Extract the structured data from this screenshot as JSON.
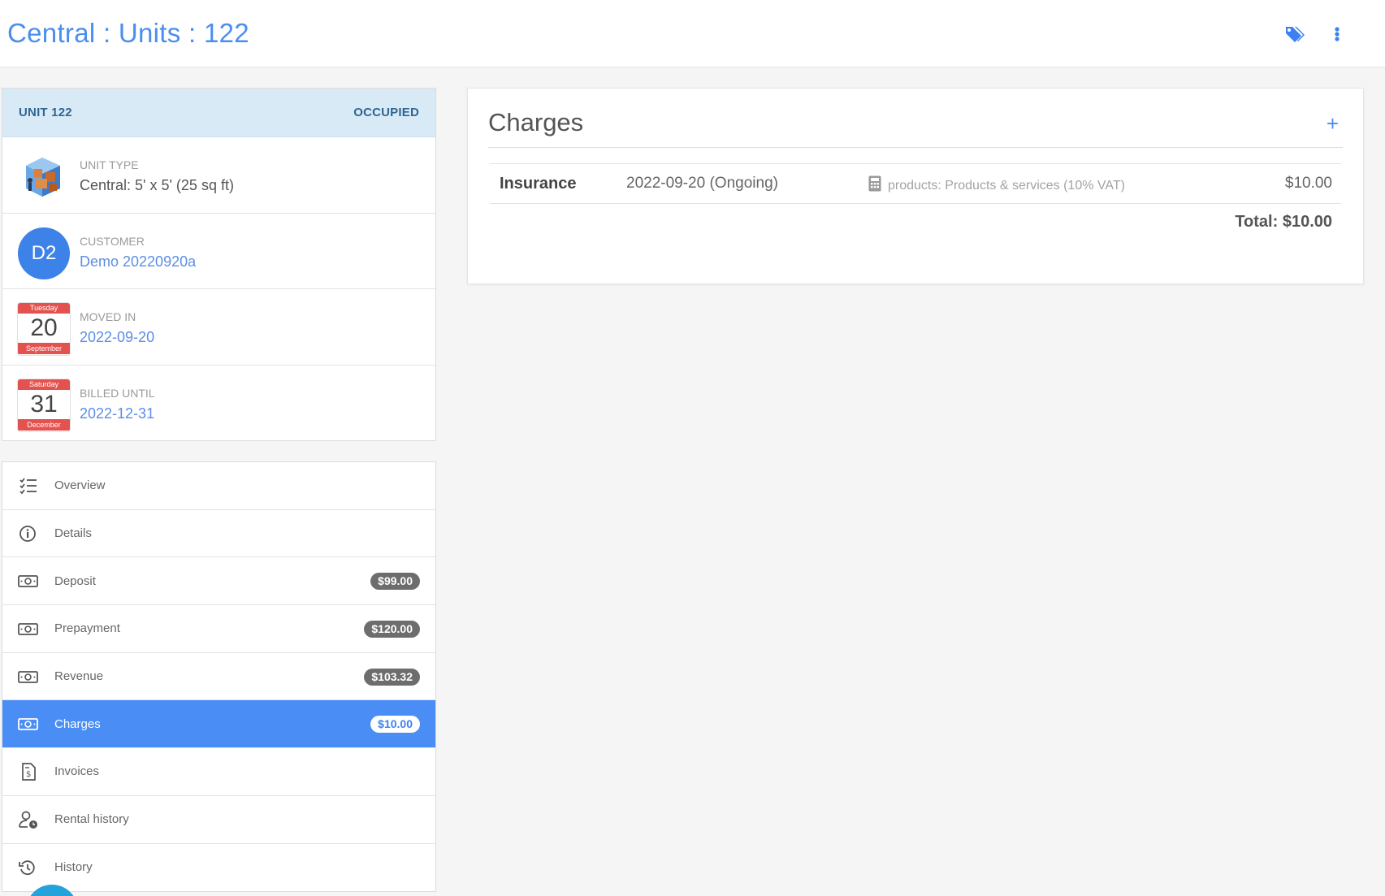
{
  "header": {
    "title": "Central : Units : 122",
    "tag_icon": "tags-icon",
    "more_icon": "more-vertical-icon"
  },
  "unit": {
    "name": "UNIT 122",
    "status": "OCCUPIED",
    "unit_type_label": "UNIT TYPE",
    "unit_type_value": "Central: 5' x 5' (25 sq ft)",
    "customer_label": "CUSTOMER",
    "customer_initials": "D2",
    "customer_value": "Demo 20220920a",
    "moved_in_label": "MOVED IN",
    "moved_in_value": "2022-09-20",
    "moved_in_cal": {
      "weekday": "Tuesday",
      "day": "20",
      "month": "September"
    },
    "billed_until_label": "BILLED UNTIL",
    "billed_until_value": "2022-12-31",
    "billed_until_cal": {
      "weekday": "Saturday",
      "day": "31",
      "month": "December"
    }
  },
  "nav": {
    "items": [
      {
        "label": "Overview",
        "icon": "checklist-icon"
      },
      {
        "label": "Details",
        "icon": "info-icon"
      },
      {
        "label": "Deposit",
        "icon": "money-icon",
        "badge": "$99.00"
      },
      {
        "label": "Prepayment",
        "icon": "money-icon",
        "badge": "$120.00"
      },
      {
        "label": "Revenue",
        "icon": "money-icon",
        "badge": "$103.32"
      },
      {
        "label": "Charges",
        "icon": "money-icon",
        "badge": "$10.00",
        "active": true
      },
      {
        "label": "Invoices",
        "icon": "invoice-icon"
      },
      {
        "label": "Rental history",
        "icon": "user-clock-icon"
      },
      {
        "label": "History",
        "icon": "history-icon"
      }
    ]
  },
  "charges": {
    "title": "Charges",
    "add_label": "+",
    "rows": [
      {
        "name": "Insurance",
        "date": "2022-09-20 (Ongoing)",
        "product": "products: Products & services (10% VAT)",
        "product_icon": "calculator-icon",
        "amount": "$10.00"
      }
    ],
    "total": "Total: $10.00"
  },
  "colors": {
    "accent": "#4a8ef5",
    "header_title": "#4a8ef0",
    "unit_header_bg": "#d9eaf7",
    "calendar_red": "#e4524f",
    "badge_gray": "#6d6d6d"
  }
}
